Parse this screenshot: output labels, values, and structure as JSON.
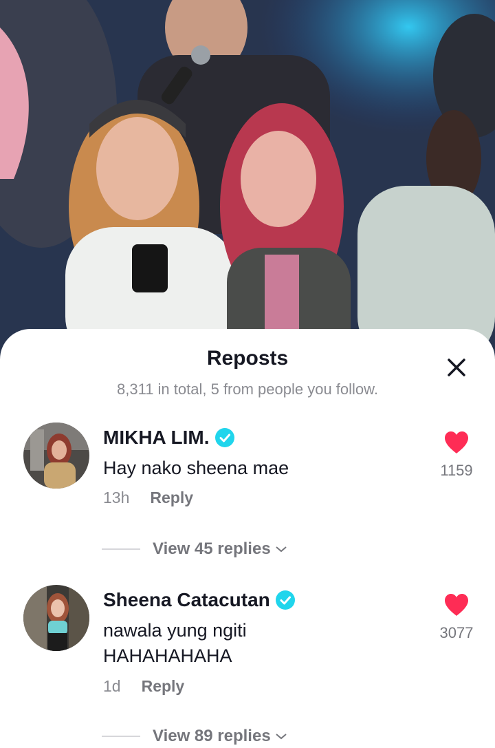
{
  "sheet": {
    "title": "Reposts",
    "subtitle": "8,311 in total, 5 from people you follow."
  },
  "icons": {
    "close": "close-icon",
    "verified": "verified-badge-icon",
    "like": "heart-icon",
    "chevron": "chevron-down-icon"
  },
  "colors": {
    "like_red": "#fe2c55",
    "verified_blue": "#20d5ec",
    "muted_text": "#8a8b91"
  },
  "comments": [
    {
      "author": "MIKHA LIM.",
      "verified": true,
      "text": "Hay nako sheena mae",
      "time": "13h",
      "reply_label": "Reply",
      "likes": "1159",
      "view_replies": "View 45 replies"
    },
    {
      "author": "Sheena Catacutan",
      "verified": true,
      "text": "nawala yung ngiti HAHAHAHAHA",
      "time": "1d",
      "reply_label": "Reply",
      "likes": "3077",
      "view_replies": "View 89 replies"
    }
  ]
}
